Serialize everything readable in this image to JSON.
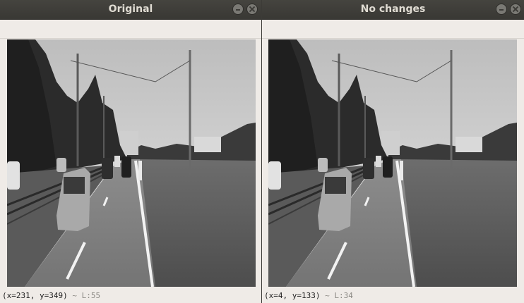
{
  "windows": [
    {
      "title": "Original",
      "status": {
        "coords": "(x=231, y=349)",
        "separator": "~",
        "luma": "L:55"
      }
    },
    {
      "title": "No changes",
      "status": {
        "coords": "(x=4, y=133)",
        "separator": "~",
        "luma": "L:34"
      }
    }
  ],
  "icons": {
    "minimize": "minimize-icon",
    "close": "close-icon"
  },
  "colors": {
    "titlebar": "#3c3b37",
    "window_bg": "#efebe7",
    "title_text": "#dfdbd2"
  }
}
